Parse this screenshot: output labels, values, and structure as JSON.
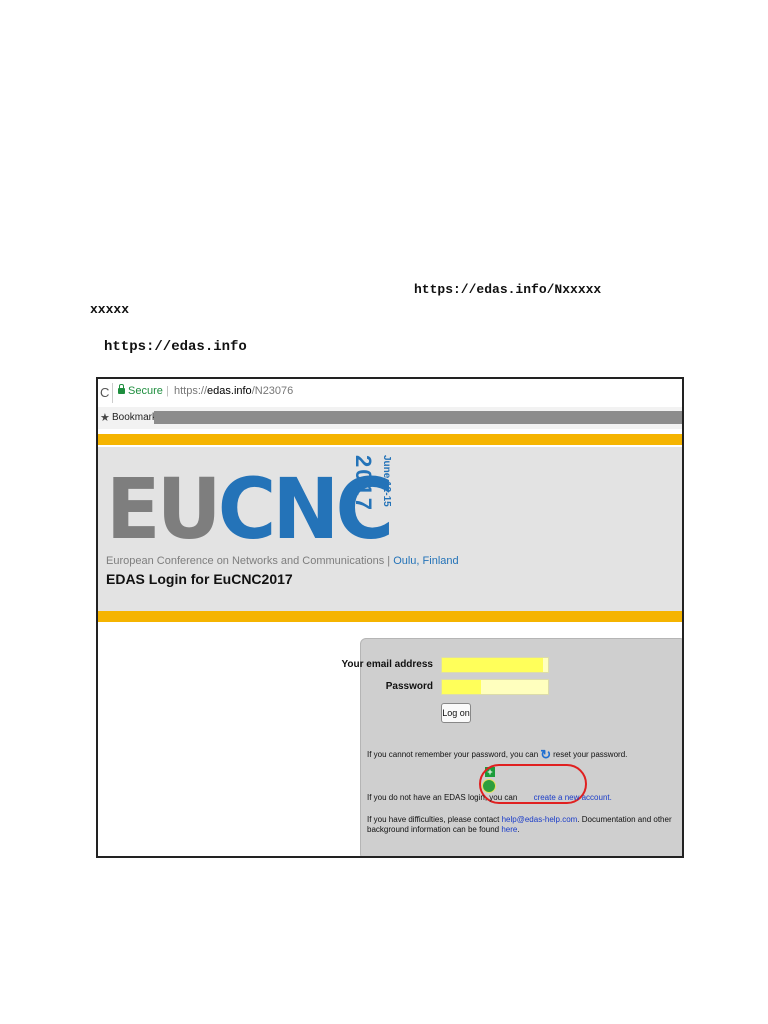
{
  "document": {
    "url_line1": "https://edas.info/Nxxxxx",
    "url_line1_cont": "xxxxx",
    "url_line2": "https://edas.info"
  },
  "browser": {
    "reload_icon": "C",
    "secure_label": "Secure",
    "address_separator": "|",
    "url_scheme": "https://",
    "url_host": "edas.info",
    "url_path": "/N23076",
    "bookmarks_label": "Bookmarks"
  },
  "header": {
    "logo_gray": "EU",
    "logo_blue": "CNC",
    "logo_year": "2017",
    "logo_dates": "June 12-15",
    "tagline": "European Conference on Networks and Communications | ",
    "tagline_city": "Oulu, Finland",
    "page_title": "EDAS Login for EuCNC2017"
  },
  "login": {
    "email_label": "Your email address",
    "email_fill_fraction": 0.95,
    "password_label": "Password",
    "password_fill_fraction": 0.37,
    "logon_button": "Log on",
    "forgot_text_before": "If you cannot remember your password, you can",
    "forgot_link": "reset your password.",
    "noaccount_text": "If you do not have an EDAS login, you can",
    "create_link": "create a new account.",
    "help_text_before": "If you have difficulties, please contact",
    "help_email": "help@edas-help.com",
    "help_text_middle": ". Documentation and other background information can be found",
    "help_here_link": "here",
    "help_text_end": "."
  },
  "colors": {
    "brand_blue": "#2473b8",
    "stripe_yellow": "#f5b400",
    "highlight_circle": "#e02020",
    "secure_green": "#1e8e3e"
  },
  "icons": [
    "reload-icon",
    "lock-icon",
    "star-icon",
    "refresh-icon",
    "add-user-icon"
  ]
}
